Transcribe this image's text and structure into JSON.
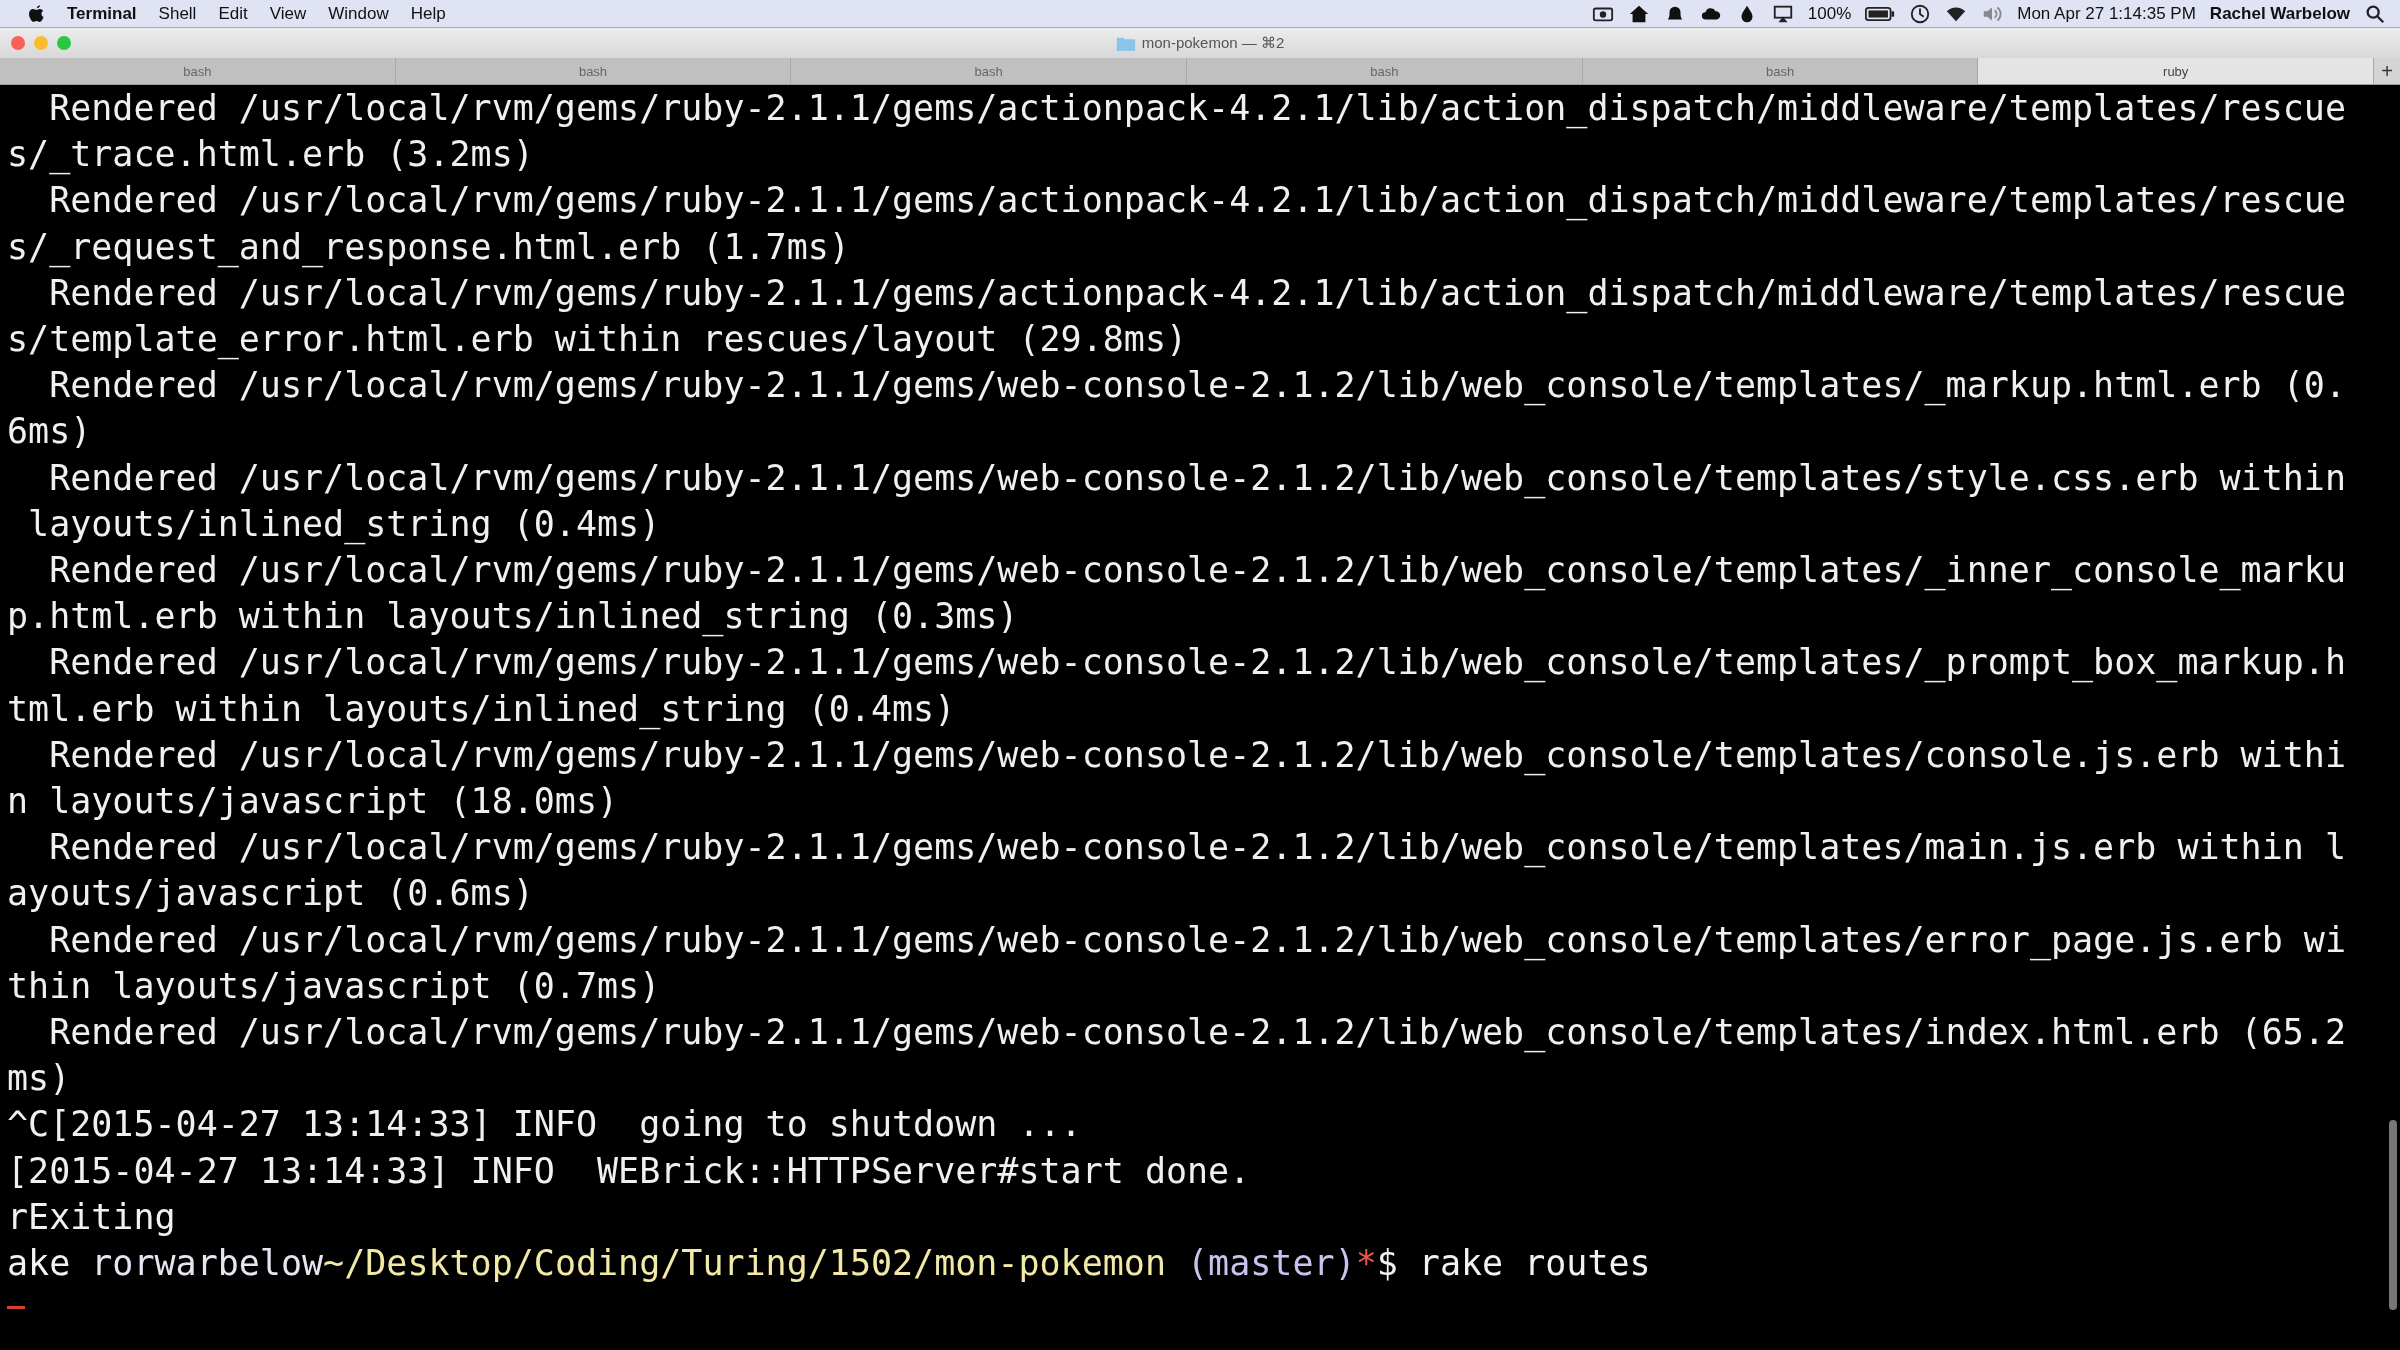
{
  "menu_bar": {
    "app": "Terminal",
    "items": [
      "Shell",
      "Edit",
      "View",
      "Window",
      "Help"
    ],
    "battery": "100%",
    "clock": "Mon Apr 27  1:14:35 PM",
    "user": "Rachel Warbelow"
  },
  "window": {
    "title": "mon-pokemon — ⌘2"
  },
  "tabs": [
    {
      "label": "bash",
      "selected": false
    },
    {
      "label": "bash",
      "selected": false
    },
    {
      "label": "bash",
      "selected": false
    },
    {
      "label": "bash",
      "selected": false
    },
    {
      "label": "bash",
      "selected": false
    },
    {
      "label": "ruby",
      "selected": true
    }
  ],
  "new_tab": "+",
  "terminal": {
    "lines": [
      "  Rendered /usr/local/rvm/gems/ruby-2.1.1/gems/actionpack-4.2.1/lib/action_dispatch/middleware/templates/rescue",
      "s/_trace.html.erb (3.2ms)",
      "  Rendered /usr/local/rvm/gems/ruby-2.1.1/gems/actionpack-4.2.1/lib/action_dispatch/middleware/templates/rescue",
      "s/_request_and_response.html.erb (1.7ms)",
      "  Rendered /usr/local/rvm/gems/ruby-2.1.1/gems/actionpack-4.2.1/lib/action_dispatch/middleware/templates/rescue",
      "s/template_error.html.erb within rescues/layout (29.8ms)",
      "  Rendered /usr/local/rvm/gems/ruby-2.1.1/gems/web-console-2.1.2/lib/web_console/templates/_markup.html.erb (0.",
      "6ms)",
      "  Rendered /usr/local/rvm/gems/ruby-2.1.1/gems/web-console-2.1.2/lib/web_console/templates/style.css.erb within",
      " layouts/inlined_string (0.4ms)",
      "  Rendered /usr/local/rvm/gems/ruby-2.1.1/gems/web-console-2.1.2/lib/web_console/templates/_inner_console_marku",
      "p.html.erb within layouts/inlined_string (0.3ms)",
      "  Rendered /usr/local/rvm/gems/ruby-2.1.1/gems/web-console-2.1.2/lib/web_console/templates/_prompt_box_markup.h",
      "tml.erb within layouts/inlined_string (0.4ms)",
      "  Rendered /usr/local/rvm/gems/ruby-2.1.1/gems/web-console-2.1.2/lib/web_console/templates/console.js.erb withi",
      "n layouts/javascript (18.0ms)",
      "  Rendered /usr/local/rvm/gems/ruby-2.1.1/gems/web-console-2.1.2/lib/web_console/templates/main.js.erb within l",
      "ayouts/javascript (0.6ms)",
      "  Rendered /usr/local/rvm/gems/ruby-2.1.1/gems/web-console-2.1.2/lib/web_console/templates/error_page.js.erb wi",
      "thin layouts/javascript (0.7ms)",
      "  Rendered /usr/local/rvm/gems/ruby-2.1.1/gems/web-console-2.1.2/lib/web_console/templates/index.html.erb (65.2",
      "ms)",
      "^C[2015-04-27 13:14:33] INFO  going to shutdown ...",
      "[2015-04-27 13:14:33] INFO  WEBrick::HTTPServer#start done.",
      "rExiting"
    ],
    "prompt": [
      {
        "text": "ake ",
        "color": "#f2f2f2"
      },
      {
        "text": "rorwarbelow",
        "color": "#e6e6f2"
      },
      {
        "text": "~/Desktop/Coding/Turing/1502/mon-pokemon",
        "color": "#f3e9a6"
      },
      {
        "text": " (master)",
        "color": "#c9c2ee"
      },
      {
        "text": "*",
        "color": "#e8584f"
      },
      {
        "text": "$ rake routes",
        "color": "#f2f2f2"
      }
    ]
  }
}
